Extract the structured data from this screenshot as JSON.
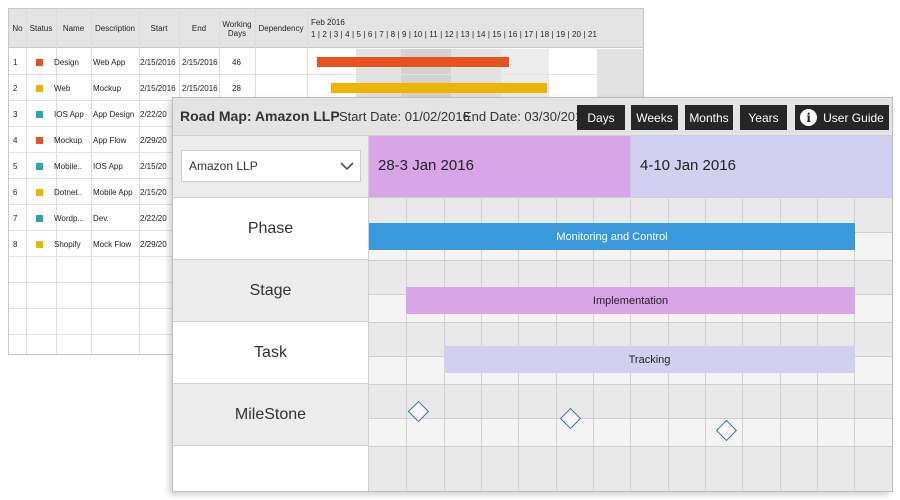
{
  "back_grid": {
    "headers": [
      "No",
      "Status",
      "Name",
      "Description",
      "Start",
      "End",
      "Working Days",
      "Dependency"
    ],
    "gantt_month": "Feb 2016",
    "gantt_days": "1 | 2 | 3 | 4 | 5 | 6 | 7 | 8 | 9 | 10 | 11 | 12 | 13 | 14 | 15 | 16 | 17 | 18 | 19 | 20 | 21",
    "rows": [
      {
        "no": "1",
        "status_color": "#e8521c",
        "name": "Design",
        "description": "Web App",
        "start": "2/15/2016",
        "end": "2/15/2016",
        "days": "46"
      },
      {
        "no": "2",
        "status_color": "#f0b400",
        "name": "Web",
        "description": "Mockup",
        "start": "2/15/2016",
        "end": "2/15/2016",
        "days": "28"
      },
      {
        "no": "3",
        "status_color": "#2aa5b4",
        "name": "IOS App",
        "description": "App Design",
        "start": "2/22/20",
        "end": "",
        "days": ""
      },
      {
        "no": "4",
        "status_color": "#e8521c",
        "name": "Mockup",
        "description": "App Flow",
        "start": "2/29/20",
        "end": "",
        "days": ""
      },
      {
        "no": "5",
        "status_color": "#2aa5b4",
        "name": "Mobile..",
        "description": "IOS App",
        "start": "2/15/20",
        "end": "",
        "days": ""
      },
      {
        "no": "6",
        "status_color": "#f0b400",
        "name": "Dotnet..",
        "description": "Mobile App",
        "start": "2/15/20",
        "end": "",
        "days": ""
      },
      {
        "no": "7",
        "status_color": "#2aa5b4",
        "name": "Wordp...",
        "description": "Dev.",
        "start": "2/22/20",
        "end": "",
        "days": ""
      },
      {
        "no": "8",
        "status_color": "#f0b400",
        "name": "Shopify",
        "description": "Mock Flow",
        "start": "2/29/20",
        "end": "",
        "days": ""
      }
    ]
  },
  "roadmap": {
    "title": "Road Map: Amazon LLP",
    "start_date": "Start Date: 01/02/2016",
    "end_date": "End Date: 03/30/2016",
    "view_buttons": [
      "Days",
      "Weeks",
      "Months",
      "Years"
    ],
    "user_guide": "User Guide",
    "company": "Amazon LLP",
    "weeks": [
      "28-3 Jan 2016",
      "4-10 Jan 2016"
    ],
    "rows": [
      "Phase",
      "Stage",
      "Task",
      "MileStone"
    ],
    "bars": {
      "phase": {
        "label": "Monitoring and Control",
        "color": "#3a98dc",
        "text_color": "#ffffff"
      },
      "stage": {
        "label": "Implementation",
        "color": "#d8a6e6",
        "text_color": "#222222"
      },
      "task": {
        "label": "Tracking",
        "color": "#d2d0f0",
        "text_color": "#222222"
      }
    },
    "colors": {
      "accent_dark": "#262626",
      "week1": "#d8a6e6",
      "week2": "#d2d0f0",
      "milestone": "#2f73b6"
    }
  }
}
